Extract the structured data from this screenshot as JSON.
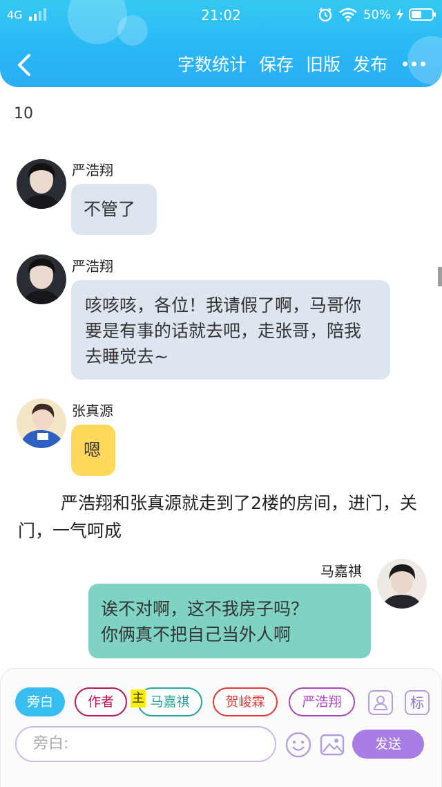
{
  "status_bar": {
    "network": "4G",
    "time": "21:02",
    "battery": "50%",
    "battery_level": 0.5
  },
  "header": {
    "actions": [
      "字数统计",
      "保存",
      "旧版",
      "发布"
    ]
  },
  "content": {
    "counter": "10",
    "messages": [
      {
        "name": "严浩翔",
        "text": "不管了"
      },
      {
        "name": "严浩翔",
        "text": "咳咳咳，各位！我请假了啊，马哥你要是有事的话就去吧，走张哥，陪我去睡觉去~"
      },
      {
        "name": "张真源",
        "text": "嗯"
      },
      {
        "name": "马嘉祺",
        "text": "诶不对啊，这不我房子吗？\n你俩真不把自己当外人啊"
      }
    ],
    "narration": "严浩翔和张真源就走到了2楼的房间，进门，关门，一气呵成"
  },
  "composer": {
    "roles": [
      "旁白",
      "作者",
      "马嘉祺",
      "贺峻霖",
      "严浩翔"
    ],
    "main_tag": "主",
    "tag_button": "标",
    "input_placeholder": "旁白:",
    "send_label": "发送"
  },
  "colors": {
    "header": "#29b6f6",
    "send": "#a87ee6",
    "narrator_chip": "#38bdf0"
  }
}
